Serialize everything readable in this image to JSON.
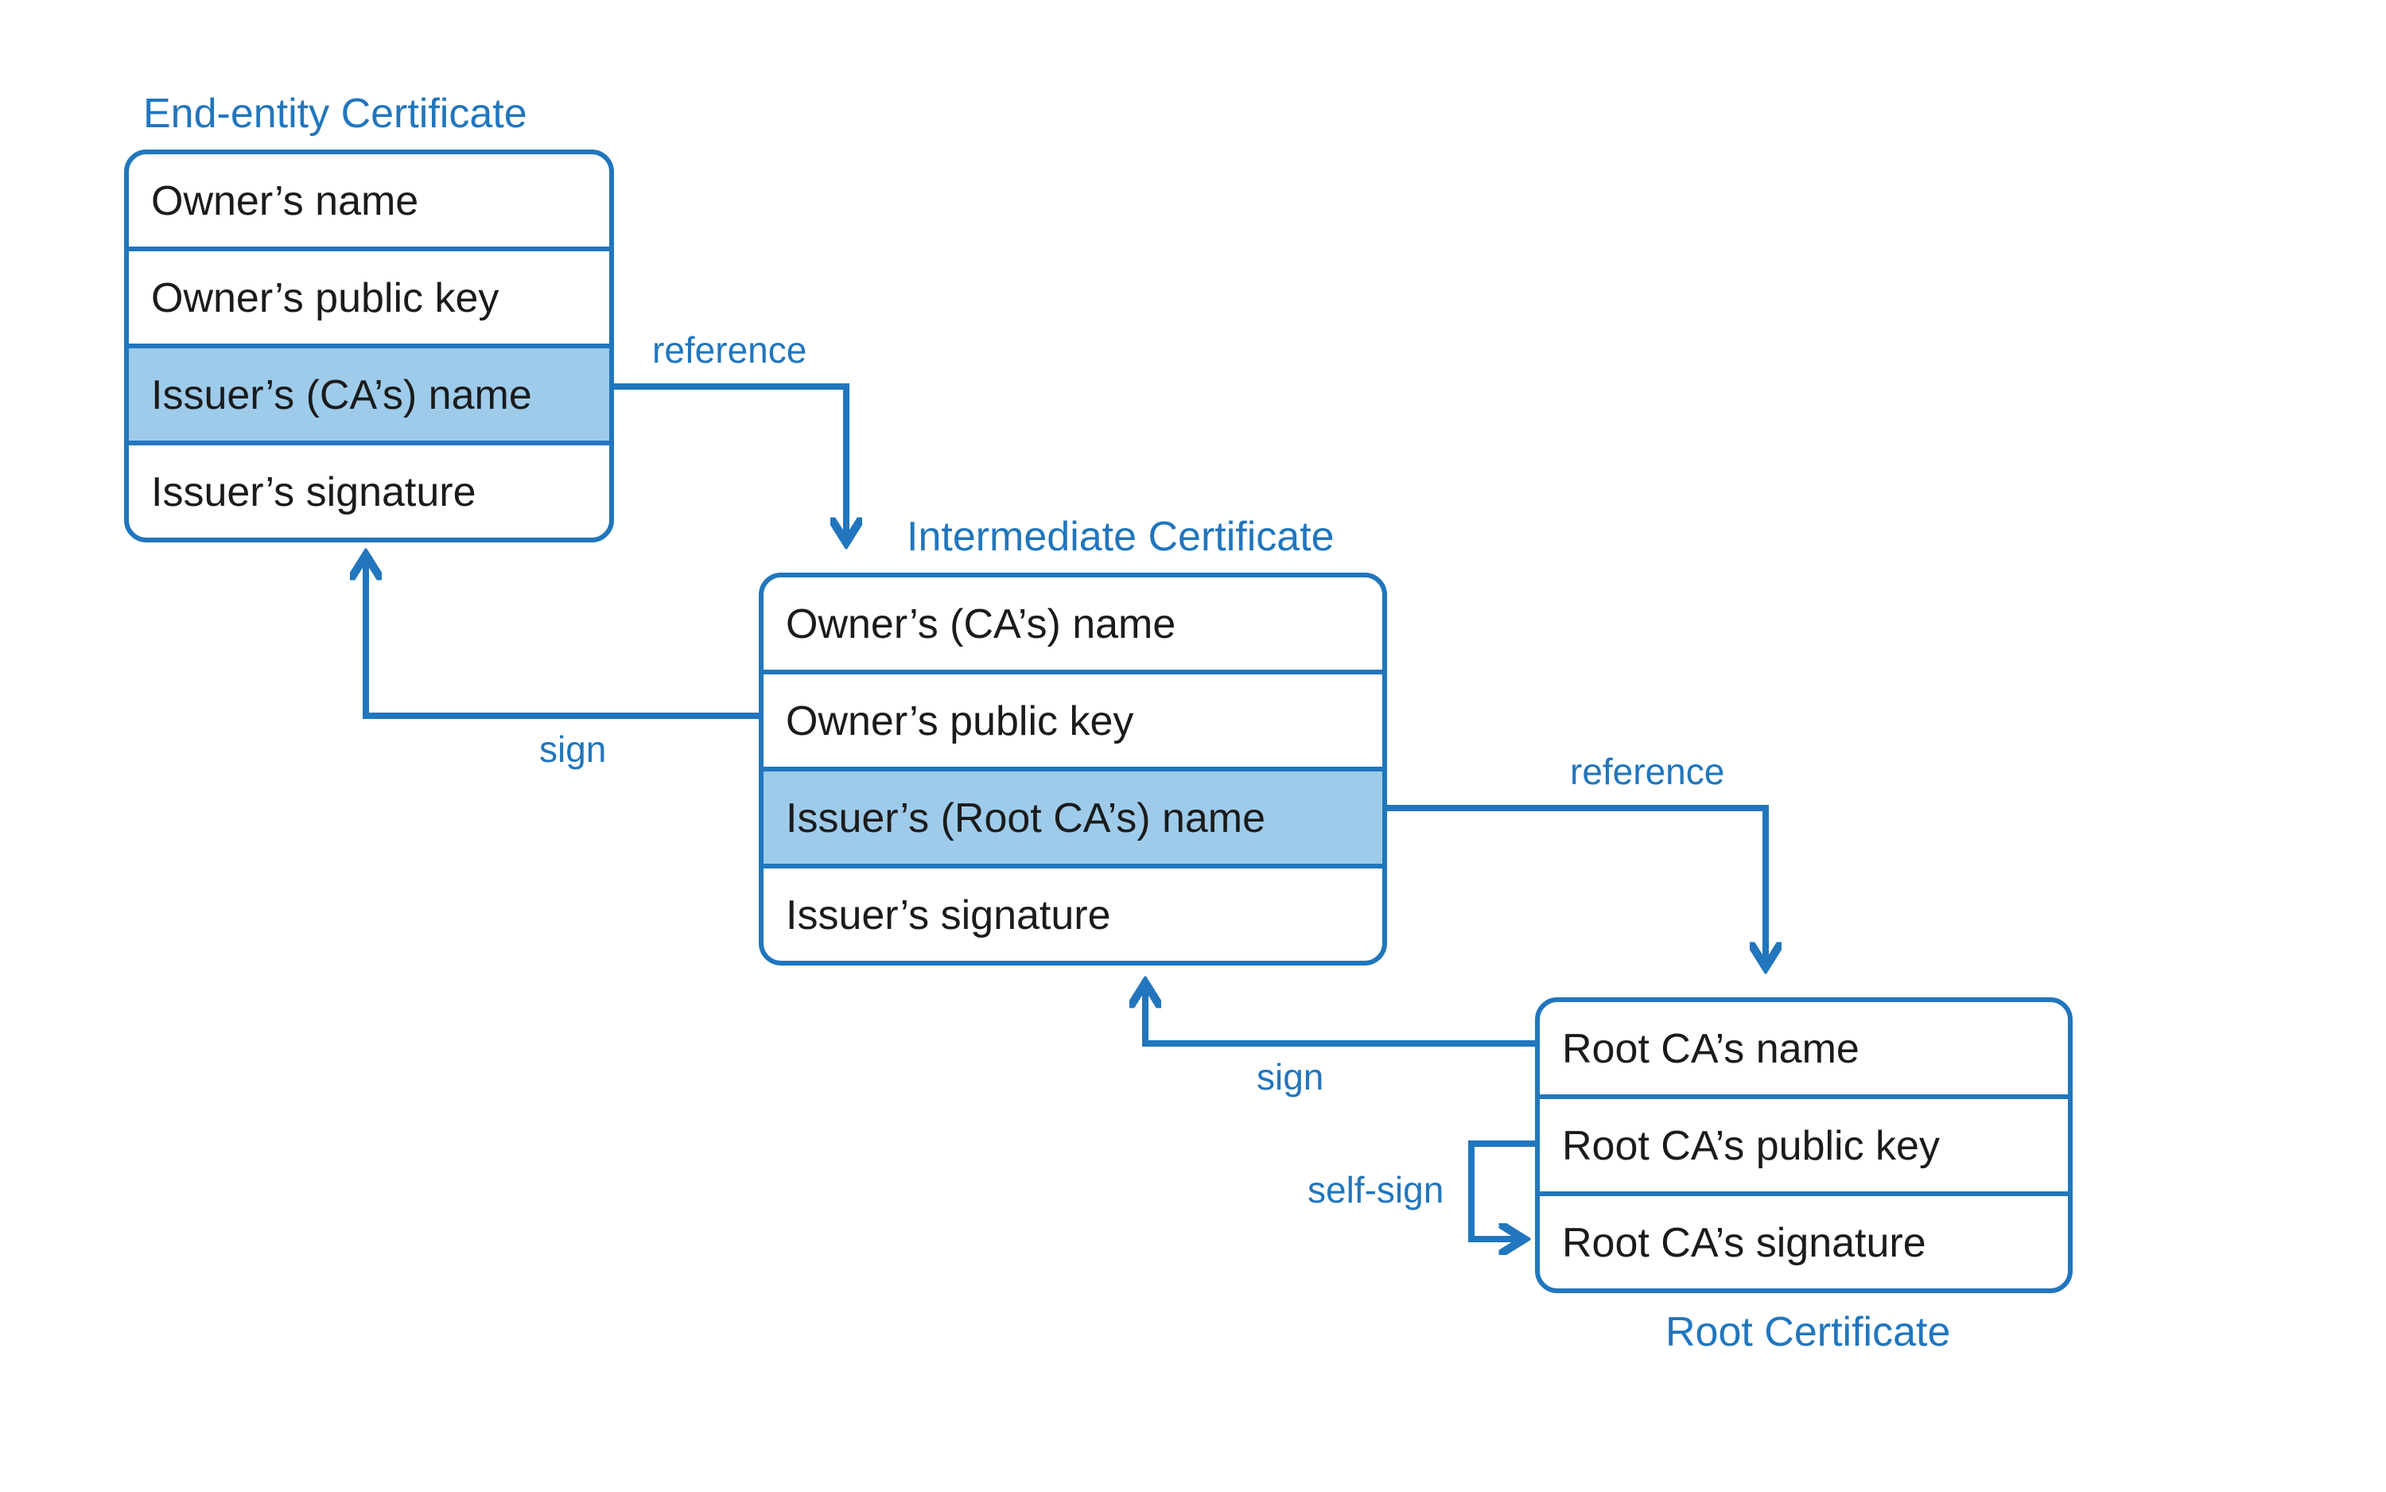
{
  "colors": {
    "accent": "#2176bd",
    "highlight_fill": "#9ecbea",
    "text": "#1b1b1b"
  },
  "certificates": {
    "end_entity": {
      "title": "End-entity Certificate",
      "rows": [
        {
          "label": "Owner’s name",
          "highlight": false
        },
        {
          "label": "Owner’s public key",
          "highlight": false
        },
        {
          "label": "Issuer’s (CA’s) name",
          "highlight": true
        },
        {
          "label": "Issuer’s signature",
          "highlight": false
        }
      ]
    },
    "intermediate": {
      "title": "Intermediate Certificate",
      "rows": [
        {
          "label": "Owner’s (CA’s) name",
          "highlight": false
        },
        {
          "label": "Owner’s public key",
          "highlight": false
        },
        {
          "label": "Issuer’s (Root CA’s) name",
          "highlight": true
        },
        {
          "label": "Issuer’s signature",
          "highlight": false
        }
      ]
    },
    "root": {
      "title": "Root Certificate",
      "rows": [
        {
          "label": "Root CA’s name",
          "highlight": false
        },
        {
          "label": "Root CA’s public key",
          "highlight": false
        },
        {
          "label": "Root CA’s signature",
          "highlight": false
        }
      ]
    }
  },
  "edges": {
    "ref1": "reference",
    "ref2": "reference",
    "sign1": "sign",
    "sign2": "sign",
    "self_sign": "self-sign"
  }
}
